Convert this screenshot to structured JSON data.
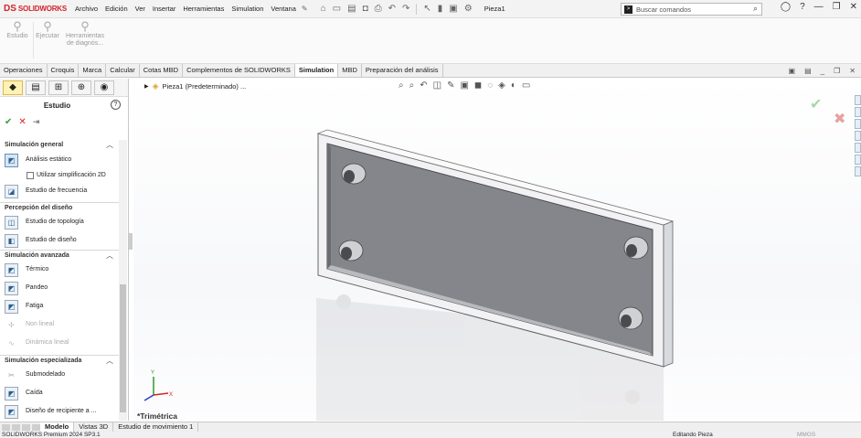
{
  "app": {
    "brand_ds": "DS",
    "brand_name": "SOLIDWORKS"
  },
  "menu": [
    "Archivo",
    "Edición",
    "Ver",
    "Insertar",
    "Herramientas",
    "Simulation",
    "Ventana"
  ],
  "document_name": "Pieza1",
  "search": {
    "placeholder": "Buscar comandos"
  },
  "ribbon": [
    {
      "label": "Estudio",
      "icon": "study-icon",
      "enabled": false
    },
    {
      "label": "Ejecutar",
      "icon": "run-icon",
      "enabled": false
    },
    {
      "label": "Herramientas de diagnós...",
      "icon": "diagnostic-icon",
      "enabled": false
    }
  ],
  "command_tabs": [
    "Operaciones",
    "Croquis",
    "Marca",
    "Calcular",
    "Cotas MBD",
    "Complementos de SOLIDWORKS",
    "Simulation",
    "MBD",
    "Preparación del análisis"
  ],
  "active_command_tab": "Simulation",
  "property_manager": {
    "title": "Estudio",
    "groups": [
      {
        "label": "Simulación general",
        "items": [
          {
            "label": "Análisis estático",
            "enabled": true,
            "selected": true
          },
          {
            "checkbox": true,
            "label": "Utilizar simplificación 2D",
            "checked": false
          },
          {
            "label": "Estudio de frecuencia",
            "enabled": true
          }
        ]
      },
      {
        "label": "Percepción del diseño",
        "items": [
          {
            "label": "Estudio de topología",
            "enabled": true
          },
          {
            "label": "Estudio de diseño",
            "enabled": true
          }
        ]
      },
      {
        "label": "Simulación avanzada",
        "items": [
          {
            "label": "Térmico",
            "enabled": true
          },
          {
            "label": "Pandeo",
            "enabled": true
          },
          {
            "label": "Fatiga",
            "enabled": true
          },
          {
            "label": "Non lineal",
            "enabled": false
          },
          {
            "label": "Dinámica lineal",
            "enabled": false
          }
        ]
      },
      {
        "label": "Simulación especializada",
        "items": [
          {
            "label": "Submodelado",
            "enabled": true
          },
          {
            "label": "Caída",
            "enabled": true
          },
          {
            "label": "Diseño de recipiente a ...",
            "enabled": true
          }
        ]
      }
    ]
  },
  "viewport": {
    "tree_item": "Pieza1 (Predeterminado) ...",
    "view_orientation": "*Trimétrica"
  },
  "bottom_tabs": [
    "Modelo",
    "Vistas 3D",
    "Estudio de movimiento 1"
  ],
  "active_bottom_tab": "Modelo",
  "status": {
    "version": "SOLIDWORKS Premium 2024 SP3.1",
    "mode": "Editando Pieza",
    "units": "MMGS"
  },
  "colors": {
    "brand": "#d2232a",
    "accent": "#e0b94a",
    "plate_face": "#84868b",
    "plate_frame": "#f0f0f2"
  }
}
